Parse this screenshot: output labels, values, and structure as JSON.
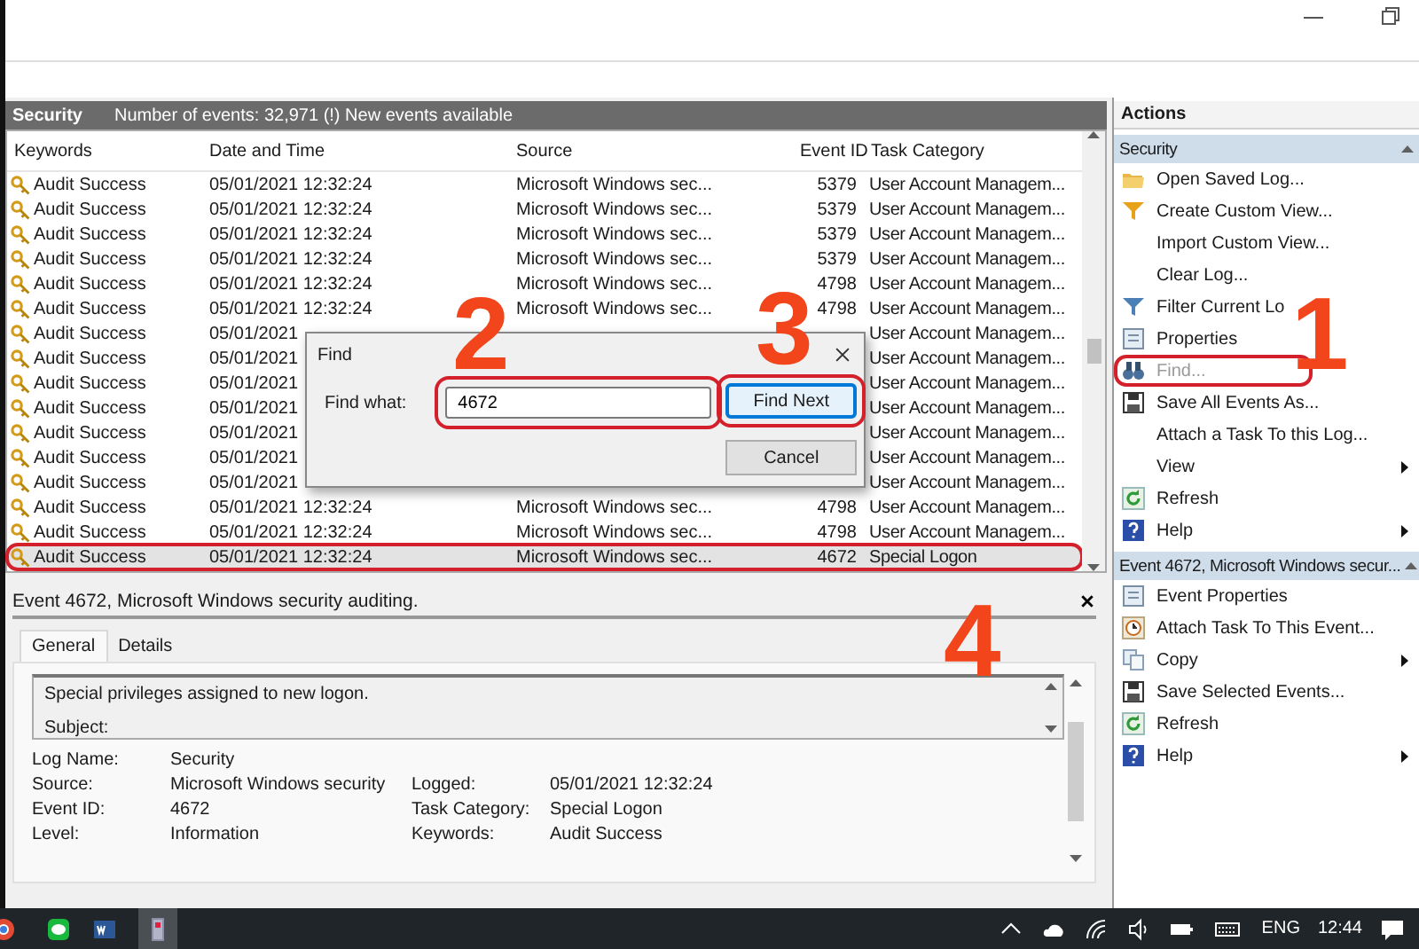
{
  "log_header": {
    "title": "Security",
    "summary": "Number of events: 32,971 (!) New events available"
  },
  "table": {
    "columns": [
      "Keywords",
      "Date and Time",
      "Source",
      "Event ID",
      "Task Category"
    ],
    "rows": [
      {
        "keywords": "Audit Success",
        "date": "05/01/2021 12:32:24",
        "source": "Microsoft Windows sec...",
        "event_id": "5379",
        "category": "User Account Managem...",
        "selected": false,
        "highlighted": false
      },
      {
        "keywords": "Audit Success",
        "date": "05/01/2021 12:32:24",
        "source": "Microsoft Windows sec...",
        "event_id": "5379",
        "category": "User Account Managem...",
        "selected": false,
        "highlighted": false
      },
      {
        "keywords": "Audit Success",
        "date": "05/01/2021 12:32:24",
        "source": "Microsoft Windows sec...",
        "event_id": "5379",
        "category": "User Account Managem...",
        "selected": false,
        "highlighted": false
      },
      {
        "keywords": "Audit Success",
        "date": "05/01/2021 12:32:24",
        "source": "Microsoft Windows sec...",
        "event_id": "5379",
        "category": "User Account Managem...",
        "selected": false,
        "highlighted": false
      },
      {
        "keywords": "Audit Success",
        "date": "05/01/2021 12:32:24",
        "source": "Microsoft Windows sec...",
        "event_id": "4798",
        "category": "User Account Managem...",
        "selected": false,
        "highlighted": false
      },
      {
        "keywords": "Audit Success",
        "date": "05/01/2021 12:32:24",
        "source": "Microsoft Windows sec...",
        "event_id": "4798",
        "category": "User Account Managem...",
        "selected": false,
        "highlighted": false
      },
      {
        "keywords": "Audit Success",
        "date": "05/01/2021",
        "category": "User Account Managem...",
        "selected": false,
        "highlighted": false
      },
      {
        "keywords": "Audit Success",
        "date": "05/01/2021",
        "category": "User Account Managem...",
        "selected": false,
        "highlighted": false
      },
      {
        "keywords": "Audit Success",
        "date": "05/01/2021",
        "category": "User Account Managem...",
        "selected": false,
        "highlighted": false
      },
      {
        "keywords": "Audit Success",
        "date": "05/01/2021",
        "category": "User Account Managem...",
        "selected": false,
        "highlighted": false
      },
      {
        "keywords": "Audit Success",
        "date": "05/01/2021",
        "category": "User Account Managem...",
        "selected": false,
        "highlighted": false
      },
      {
        "keywords": "Audit Success",
        "date": "05/01/2021",
        "category": "User Account Managem...",
        "selected": false,
        "highlighted": false
      },
      {
        "keywords": "Audit Success",
        "date": "05/01/2021",
        "category": "User Account Managem...",
        "selected": false,
        "highlighted": false
      },
      {
        "keywords": "Audit Success",
        "date": "05/01/2021 12:32:24",
        "source": "Microsoft Windows sec...",
        "event_id": "4798",
        "category": "User Account Managem...",
        "selected": false,
        "highlighted": false
      },
      {
        "keywords": "Audit Success",
        "date": "05/01/2021 12:32:24",
        "source": "Microsoft Windows sec...",
        "event_id": "4798",
        "category": "User Account Managem...",
        "selected": false,
        "highlighted": false
      },
      {
        "keywords": "Audit Success",
        "date": "05/01/2021 12:32:24",
        "source": "Microsoft Windows sec...",
        "event_id": "4672",
        "category": "Special Logon",
        "selected": true,
        "highlighted": true
      }
    ]
  },
  "find_dialog": {
    "title": "Find",
    "label": "Find what:",
    "value": "4672",
    "highlighted": true,
    "buttons": [
      {
        "label": "Find Next",
        "default": true,
        "highlighted": true
      },
      {
        "label": "Cancel",
        "default": false,
        "highlighted": false
      }
    ]
  },
  "details": {
    "title": "Event 4672, Microsoft Windows security auditing.",
    "tabs": [
      {
        "label": "General",
        "selected": true
      },
      {
        "label": "Details",
        "selected": false
      }
    ],
    "description": [
      "Special privileges assigned to new logon.",
      "Subject:"
    ],
    "left_fields": [
      {
        "label": "Log Name:",
        "value": "Security"
      },
      {
        "label": "Source:",
        "value": "Microsoft Windows security"
      },
      {
        "label": "Event ID:",
        "value": "4672"
      },
      {
        "label": "Level:",
        "value": "Information"
      }
    ],
    "right_fields": [
      {
        "label": "Logged:",
        "value": "05/01/2021 12:32:24"
      },
      {
        "label": "Task Category:",
        "value": "Special Logon"
      },
      {
        "label": "Keywords:",
        "value": "Audit Success"
      }
    ]
  },
  "actions": {
    "title": "Actions",
    "sections": [
      {
        "title": "Security",
        "expanded": true,
        "items": [
          {
            "label": "Open Saved Log...",
            "disabled": false,
            "submenu": false,
            "highlighted": false
          },
          {
            "label": "Create Custom View...",
            "disabled": false,
            "submenu": false,
            "highlighted": false
          },
          {
            "label": "Import Custom View...",
            "disabled": false,
            "submenu": false,
            "highlighted": false
          },
          {
            "label": "Clear Log...",
            "disabled": false,
            "submenu": false,
            "highlighted": false
          },
          {
            "label": "Filter Current Lo",
            "disabled": false,
            "submenu": false,
            "highlighted": false
          },
          {
            "label": "Properties",
            "disabled": false,
            "submenu": false,
            "highlighted": false
          },
          {
            "label": "Find...",
            "disabled": true,
            "submenu": false,
            "highlighted": true
          },
          {
            "label": "Save All Events As...",
            "disabled": false,
            "submenu": false,
            "highlighted": false
          },
          {
            "label": "Attach a Task To this Log...",
            "disabled": false,
            "submenu": false,
            "highlighted": false
          },
          {
            "label": "View",
            "disabled": false,
            "submenu": true,
            "highlighted": false
          },
          {
            "label": "Refresh",
            "disabled": false,
            "submenu": false,
            "highlighted": false
          },
          {
            "label": "Help",
            "disabled": false,
            "submenu": true,
            "highlighted": false
          }
        ]
      },
      {
        "title": "Event 4672, Microsoft Windows secur...",
        "expanded": true,
        "items": [
          {
            "label": "Event Properties",
            "disabled": false,
            "submenu": false,
            "highlighted": false
          },
          {
            "label": "Attach Task To This Event...",
            "disabled": false,
            "submenu": false,
            "highlighted": false
          },
          {
            "label": "Copy",
            "disabled": false,
            "submenu": true,
            "highlighted": false
          },
          {
            "label": "Save Selected Events...",
            "disabled": false,
            "submenu": false,
            "highlighted": false
          },
          {
            "label": "Refresh",
            "disabled": false,
            "submenu": false,
            "highlighted": false
          },
          {
            "label": "Help",
            "disabled": false,
            "submenu": true,
            "highlighted": false
          }
        ]
      }
    ]
  },
  "step_markers": [
    "2",
    "3",
    "1",
    "4"
  ],
  "taskbar": {
    "language": "ENG",
    "time": "12:44"
  }
}
